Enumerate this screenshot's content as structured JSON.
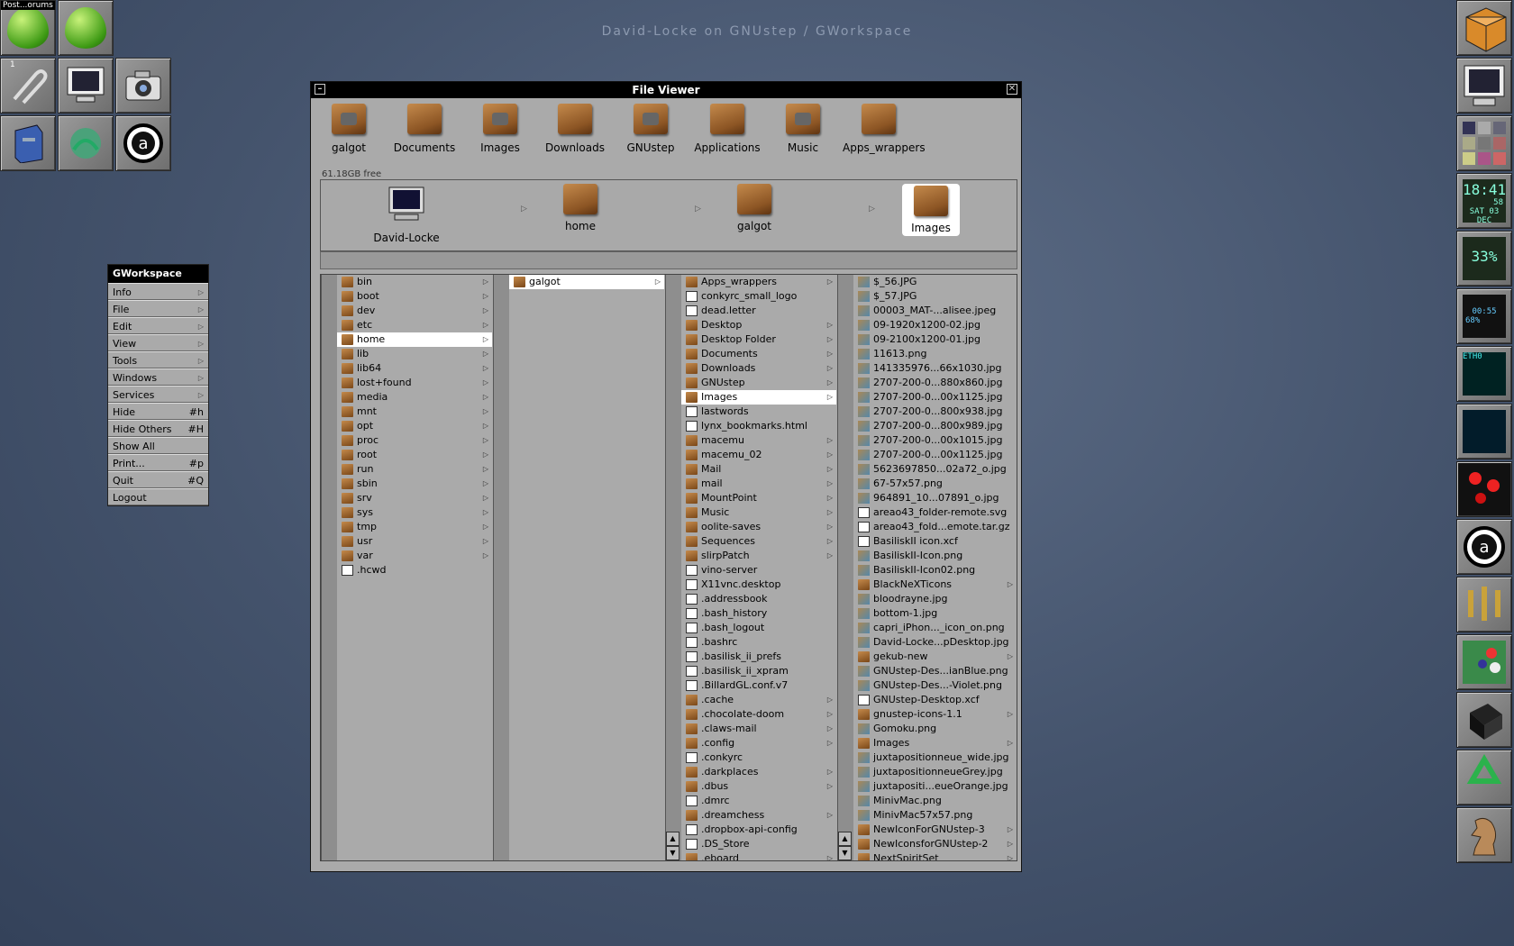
{
  "desktop": {
    "title": "David-Locke on GNUstep / GWorkspace"
  },
  "left_dock": {
    "tile_label": "Post...orums",
    "tile_number": "1"
  },
  "menu": {
    "title": "GWorkspace",
    "items": [
      {
        "label": "Info",
        "key": "",
        "sub": true
      },
      {
        "label": "File",
        "key": "",
        "sub": true
      },
      {
        "label": "Edit",
        "key": "",
        "sub": true
      },
      {
        "label": "View",
        "key": "",
        "sub": true
      },
      {
        "label": "Tools",
        "key": "",
        "sub": true
      },
      {
        "label": "Windows",
        "key": "",
        "sub": true
      },
      {
        "label": "Services",
        "key": "",
        "sub": true
      },
      {
        "label": "Hide",
        "key": "#h",
        "sub": false
      },
      {
        "label": "Hide Others",
        "key": "#H",
        "sub": false
      },
      {
        "label": "Show All",
        "key": "",
        "sub": false
      },
      {
        "label": "Print...",
        "key": "#p",
        "sub": false
      },
      {
        "label": "Quit",
        "key": "#Q",
        "sub": false
      },
      {
        "label": "Logout",
        "key": "",
        "sub": false
      }
    ]
  },
  "window": {
    "title": "File Viewer",
    "free_space": "61.18GB free",
    "shelf": [
      "galgot",
      "Documents",
      "Images",
      "Downloads",
      "GNUstep",
      "Applications",
      "Music",
      "Apps_wrappers"
    ],
    "path": [
      "David-Locke",
      "home",
      "galgot",
      "Images"
    ],
    "columns": [
      {
        "items": [
          {
            "n": "bin",
            "d": true
          },
          {
            "n": "boot",
            "d": true
          },
          {
            "n": "dev",
            "d": true
          },
          {
            "n": "etc",
            "d": true
          },
          {
            "n": "home",
            "d": true,
            "s": true
          },
          {
            "n": "lib",
            "d": true
          },
          {
            "n": "lib64",
            "d": true
          },
          {
            "n": "lost+found",
            "d": true
          },
          {
            "n": "media",
            "d": true
          },
          {
            "n": "mnt",
            "d": true
          },
          {
            "n": "opt",
            "d": true
          },
          {
            "n": "proc",
            "d": true
          },
          {
            "n": "root",
            "d": true
          },
          {
            "n": "run",
            "d": true
          },
          {
            "n": "sbin",
            "d": true
          },
          {
            "n": "srv",
            "d": true
          },
          {
            "n": "sys",
            "d": true
          },
          {
            "n": "tmp",
            "d": true
          },
          {
            "n": "usr",
            "d": true
          },
          {
            "n": "var",
            "d": true
          },
          {
            "n": ".hcwd",
            "d": false
          }
        ]
      },
      {
        "items": [
          {
            "n": "galgot",
            "d": true,
            "s": true
          }
        ]
      },
      {
        "items": [
          {
            "n": "Apps_wrappers",
            "d": true
          },
          {
            "n": "conkyrc_small_logo",
            "d": false
          },
          {
            "n": "dead.letter",
            "d": false
          },
          {
            "n": "Desktop",
            "d": true
          },
          {
            "n": "Desktop Folder",
            "d": true
          },
          {
            "n": "Documents",
            "d": true
          },
          {
            "n": "Downloads",
            "d": true
          },
          {
            "n": "GNUstep",
            "d": true
          },
          {
            "n": "Images",
            "d": true,
            "s": true
          },
          {
            "n": "lastwords",
            "d": false
          },
          {
            "n": "lynx_bookmarks.html",
            "d": false
          },
          {
            "n": "macemu",
            "d": true
          },
          {
            "n": "macemu_02",
            "d": true
          },
          {
            "n": "Mail",
            "d": true
          },
          {
            "n": "mail",
            "d": true
          },
          {
            "n": "MountPoint",
            "d": true
          },
          {
            "n": "Music",
            "d": true
          },
          {
            "n": "oolite-saves",
            "d": true
          },
          {
            "n": "Sequences",
            "d": true
          },
          {
            "n": "slirpPatch",
            "d": true
          },
          {
            "n": "vino-server",
            "d": false
          },
          {
            "n": "X11vnc.desktop",
            "d": false
          },
          {
            "n": ".addressbook",
            "d": false
          },
          {
            "n": ".bash_history",
            "d": false
          },
          {
            "n": ".bash_logout",
            "d": false
          },
          {
            "n": ".bashrc",
            "d": false
          },
          {
            "n": ".basilisk_ii_prefs",
            "d": false
          },
          {
            "n": ".basilisk_ii_xpram",
            "d": false
          },
          {
            "n": ".BillardGL.conf.v7",
            "d": false
          },
          {
            "n": ".cache",
            "d": true
          },
          {
            "n": ".chocolate-doom",
            "d": true
          },
          {
            "n": ".claws-mail",
            "d": true
          },
          {
            "n": ".config",
            "d": true
          },
          {
            "n": ".conkyrc",
            "d": false
          },
          {
            "n": ".darkplaces",
            "d": true
          },
          {
            "n": ".dbus",
            "d": true
          },
          {
            "n": ".dmrc",
            "d": false
          },
          {
            "n": ".dreamchess",
            "d": true
          },
          {
            "n": ".dropbox-api-config",
            "d": false
          },
          {
            "n": ".DS_Store",
            "d": false
          },
          {
            "n": ".eboard",
            "d": true
          }
        ]
      },
      {
        "items": [
          {
            "n": "$_56.JPG",
            "i": true
          },
          {
            "n": "$_57.JPG",
            "i": true
          },
          {
            "n": "00003_MAT-...alisee.jpeg",
            "i": true
          },
          {
            "n": "09-1920x1200-02.jpg",
            "i": true
          },
          {
            "n": "09-2100x1200-01.jpg",
            "i": true
          },
          {
            "n": "11613.png",
            "i": true
          },
          {
            "n": "141335976...66x1030.jpg",
            "i": true
          },
          {
            "n": "2707-200-0...880x860.jpg",
            "i": true
          },
          {
            "n": "2707-200-0...00x1125.jpg",
            "i": true
          },
          {
            "n": "2707-200-0...800x938.jpg",
            "i": true
          },
          {
            "n": "2707-200-0...800x989.jpg",
            "i": true
          },
          {
            "n": "2707-200-0...00x1015.jpg",
            "i": true
          },
          {
            "n": "2707-200-0...00x1125.jpg",
            "i": true
          },
          {
            "n": "5623697850...02a72_o.jpg",
            "i": true
          },
          {
            "n": "67-57x57.png",
            "i": true
          },
          {
            "n": "964891_10...07891_o.jpg",
            "i": true
          },
          {
            "n": "areao43_folder-remote.svg",
            "i": false
          },
          {
            "n": "areao43_fold...emote.tar.gz",
            "i": false
          },
          {
            "n": "BasiliskII icon.xcf",
            "i": false
          },
          {
            "n": "BasiliskII-Icon.png",
            "i": true
          },
          {
            "n": "BasiliskII-Icon02.png",
            "i": true
          },
          {
            "n": "BlackNeXTicons",
            "d": true
          },
          {
            "n": "bloodrayne.jpg",
            "i": true
          },
          {
            "n": "bottom-1.jpg",
            "i": true
          },
          {
            "n": "capri_iPhon..._icon_on.png",
            "i": true
          },
          {
            "n": "David-Locke...pDesktop.jpg",
            "i": true
          },
          {
            "n": "gekub-new",
            "d": true
          },
          {
            "n": "GNUstep-Des...ianBlue.png",
            "i": true
          },
          {
            "n": "GNUstep-Des...-Violet.png",
            "i": true
          },
          {
            "n": "GNUstep-Desktop.xcf",
            "i": false
          },
          {
            "n": "gnustep-icons-1.1",
            "d": true
          },
          {
            "n": "Gomoku.png",
            "i": true
          },
          {
            "n": "Images",
            "d": true
          },
          {
            "n": "juxtapositionneue_wide.jpg",
            "i": true
          },
          {
            "n": "juxtapositionneueGrey.jpg",
            "i": true
          },
          {
            "n": "juxtapositi...eueOrange.jpg",
            "i": true
          },
          {
            "n": "MinivMac.png",
            "i": true
          },
          {
            "n": "MinivMac57x57.png",
            "i": true
          },
          {
            "n": "NewIconForGNUstep-3",
            "d": true
          },
          {
            "n": "NewIconsforGNUstep-2",
            "d": true
          },
          {
            "n": "NextSpiritSet",
            "d": true
          }
        ]
      }
    ]
  },
  "right_dock": {
    "clock": {
      "time": "18:41",
      "seconds": "58",
      "date": "SAT 03 DEC"
    },
    "cpu": "33%",
    "battery": {
      "time": "00:55",
      "percent": "68%"
    },
    "net": "ETH0"
  }
}
